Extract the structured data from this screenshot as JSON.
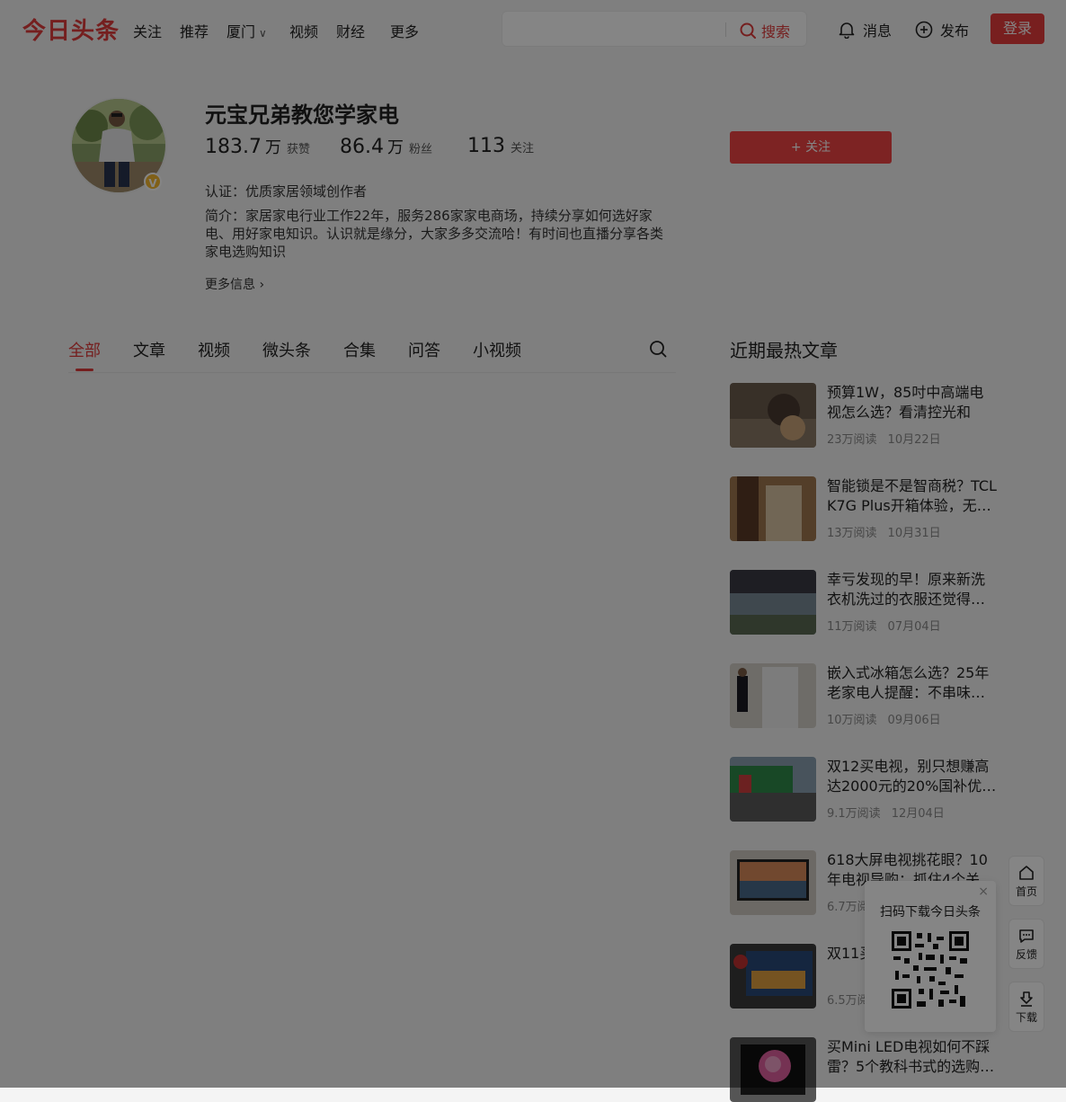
{
  "header": {
    "logo": "今日头条",
    "nav": [
      {
        "label": "关注"
      },
      {
        "label": "推荐"
      },
      {
        "label": "厦门",
        "has_dropdown": true
      },
      {
        "label": "视频"
      },
      {
        "label": "财经"
      },
      {
        "label": "更多"
      }
    ],
    "search": {
      "placeholder": "",
      "button_label": "搜索",
      "icon": "search-icon"
    },
    "messages_label": "消息",
    "publish_label": "发布",
    "login_label": "登录"
  },
  "profile": {
    "name": "元宝兄弟教您学家电",
    "stats": [
      {
        "num": "183.7",
        "unit": "万",
        "label": "获赞"
      },
      {
        "num": "86.4",
        "unit": "万",
        "label": "粉丝"
      },
      {
        "num": "113",
        "unit": "",
        "label": "关注"
      }
    ],
    "follow_label": "+ 关注",
    "verified_badge": "V",
    "certification": "认证：优质家居领域创作者",
    "bio": "简介：家居家电行业工作22年，服务286家家电商场，持续分享如何选好家电、用好家电知识。认识就是缘分，大家多多交流哈！有时间也直播分享各类家电选购知识",
    "more_info": "更多信息 ›"
  },
  "tabs": [
    {
      "label": "全部",
      "active": true
    },
    {
      "label": "文章"
    },
    {
      "label": "视频"
    },
    {
      "label": "微头条"
    },
    {
      "label": "合集"
    },
    {
      "label": "问答"
    },
    {
      "label": "小视频"
    }
  ],
  "sidebar": {
    "title": "近期最热文章",
    "articles": [
      {
        "title": "预算1W，85吋中高端电视怎么选？看清控光和屏…",
        "reads": "23万阅读",
        "date": "10月22日"
      },
      {
        "title": "智能锁是不是智商税？TCL K7G Plus开箱体验，无…",
        "reads": "13万阅读",
        "date": "10月31日"
      },
      {
        "title": "幸亏发现的早！原来新洗衣机洗过的衣服还觉得…",
        "reads": "11万阅读",
        "date": "07月04日"
      },
      {
        "title": "嵌入式冰箱怎么选？25年老家电人提醒：不串味…",
        "reads": "10万阅读",
        "date": "09月06日"
      },
      {
        "title": "双12买电视，别只想赚高达2000元的20%国补优…",
        "reads": "9.1万阅读",
        "date": "12月04日"
      },
      {
        "title": "618大屏电视挑花眼？10年电视导购：抓住4个关键…",
        "reads": "6.7万阅",
        "date": ""
      },
      {
        "title": "双11买…为什么…",
        "reads": "6.5万阅",
        "date": ""
      },
      {
        "title": "买Mini LED电视如何不踩雷？5个教科书式的选购…",
        "reads": "",
        "date": ""
      }
    ]
  },
  "qr_popup": {
    "text": "扫码下载今日头条",
    "close": "×"
  },
  "side_buttons": [
    {
      "label": "首页",
      "icon": "home-icon"
    },
    {
      "label": "反馈",
      "icon": "feedback-icon"
    },
    {
      "label": "下载",
      "icon": "download-icon"
    }
  ],
  "colors": {
    "brand": "#e03c3c",
    "follow_button": "#ef4444",
    "overlay": "rgba(0,0,0,0.48)"
  }
}
